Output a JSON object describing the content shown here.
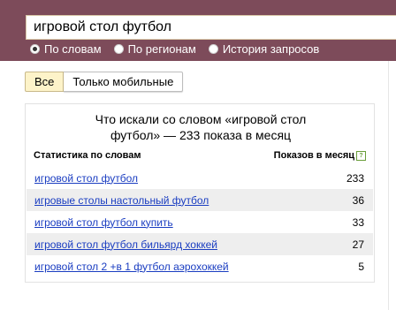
{
  "search": {
    "value": "игровой стол футбол"
  },
  "radios": [
    {
      "label": "По словам",
      "checked": true
    },
    {
      "label": "По регионам",
      "checked": false
    },
    {
      "label": "История запросов",
      "checked": false
    }
  ],
  "tabs": [
    {
      "label": "Все",
      "active": true
    },
    {
      "label": "Только мобильные",
      "active": false
    }
  ],
  "panel": {
    "title_line1": "Что искали со словом «игровой стол",
    "title_line2": "футбол» — 233 показа в месяц",
    "col_left": "Статистика по словам",
    "col_right": "Показов в месяц",
    "help_glyph": "?"
  },
  "rows": [
    {
      "phrase": "игровой стол футбол",
      "count": "233"
    },
    {
      "phrase": "игровые столы настольный футбол",
      "count": "36"
    },
    {
      "phrase": "игровой стол футбол купить",
      "count": "33"
    },
    {
      "phrase": "игровой стол футбол бильярд хоккей",
      "count": "27"
    },
    {
      "phrase": "игровой стол 2 +в 1 футбол аэрохоккей",
      "count": "5"
    }
  ],
  "colors": {
    "header": "#7d4b5a",
    "link": "#1a3dc1",
    "active_tab": "#fdf3c9"
  }
}
